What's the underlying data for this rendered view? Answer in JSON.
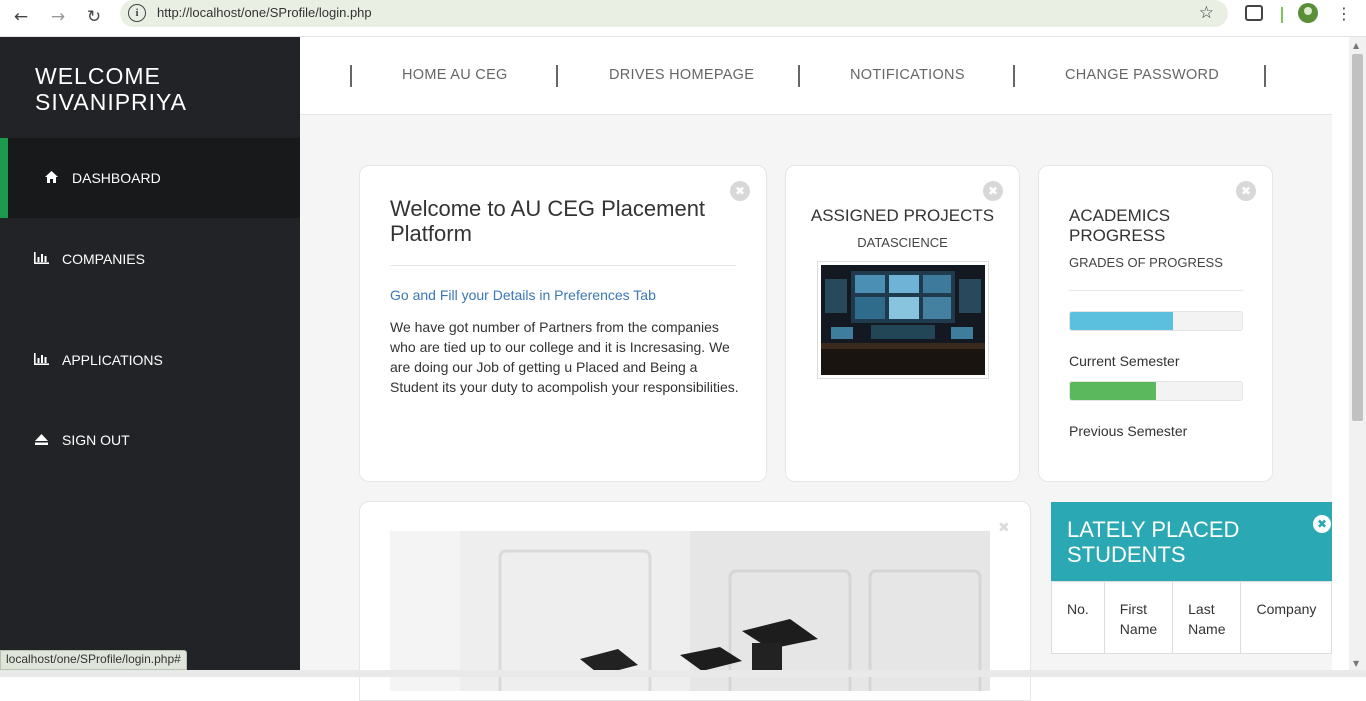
{
  "browser": {
    "url": "http://localhost/one/SProfile/login.php",
    "status_url": "localhost/one/SProfile/login.php#"
  },
  "sidebar": {
    "welcome_line1": "WELCOME",
    "welcome_line2": "SIVANIPRIYA",
    "items": [
      {
        "label": "DASHBOARD",
        "icon": "home-icon",
        "active": true
      },
      {
        "label": "COMPANIES",
        "icon": "bar-chart-icon"
      },
      {
        "label": "APPLICATIONS",
        "icon": "bar-chart-icon"
      },
      {
        "label": "SIGN OUT",
        "icon": "eject-icon"
      }
    ]
  },
  "topnav": {
    "links": [
      "HOME AU CEG",
      "DRIVES HOMEPAGE",
      "NOTIFICATIONS",
      "CHANGE PASSWORD"
    ]
  },
  "welcome_card": {
    "title": "Welcome to AU CEG Placement Platform",
    "link": "Go and Fill your Details in Preferences Tab",
    "body": "We have got number of Partners from the companies who are tied up to our college and it is Incresasing. We are doing our Job of getting u Placed and Being a Student its your duty to acompolish your responsibilities."
  },
  "projects_card": {
    "title": "ASSIGNED PROJECTS",
    "subtitle": "DATASCIENCE"
  },
  "academics_card": {
    "title": "ACADEMICS PROGRESS",
    "subtitle": "GRADES OF PROGRESS",
    "bars": [
      {
        "label": "Current Semester",
        "value": 0.6,
        "color": "#5bc0de"
      },
      {
        "label": "Previous Semester",
        "value": 0.5,
        "color": "#5cb85c"
      }
    ]
  },
  "lately_placed": {
    "title": "LATELY PLACED STUDENTS",
    "columns": [
      "No.",
      "First Name",
      "Last Name",
      "Company"
    ]
  },
  "colors": {
    "sidebar_bg": "#222327",
    "active_accent": "#1d9a4e",
    "panel_teal": "#2aa8b3"
  }
}
